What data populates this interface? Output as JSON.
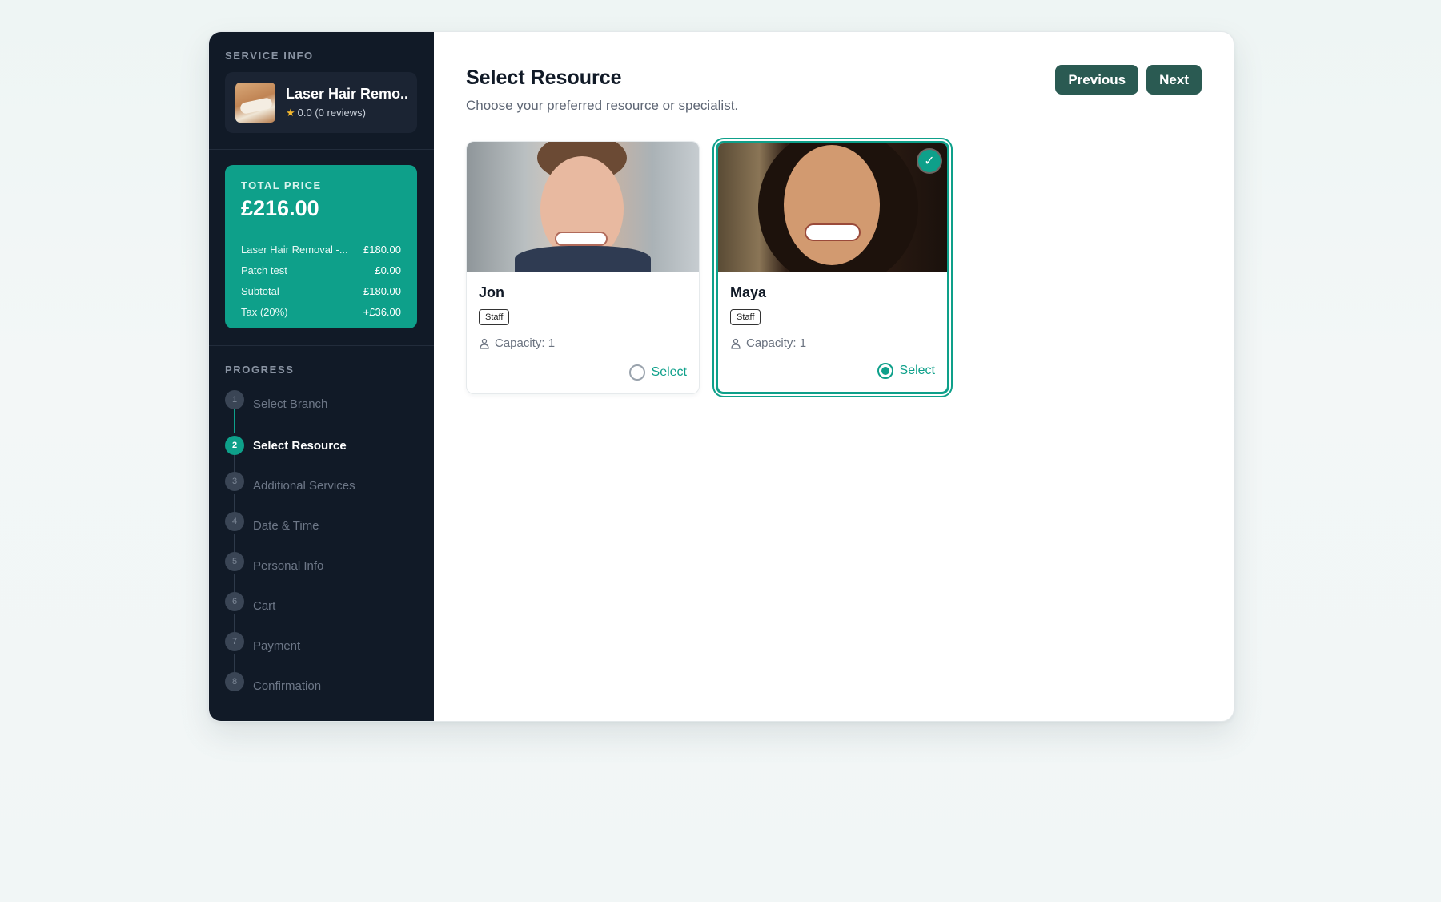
{
  "sidebar": {
    "service_info_label": "SERVICE INFO",
    "service": {
      "title": "Laser Hair Remo...",
      "rating": "0.0 (0 reviews)",
      "thumbnail_icon": "service-thumbnail"
    },
    "price": {
      "label": "TOTAL PRICE",
      "total": "£216.00",
      "rows": [
        {
          "name": "Laser Hair Removal -...",
          "value": "£180.00"
        },
        {
          "name": "Patch test",
          "value": "£0.00"
        },
        {
          "name": "Subtotal",
          "value": "£180.00"
        },
        {
          "name": "Tax (20%)",
          "value": "+£36.00"
        }
      ]
    },
    "progress_label": "PROGRESS",
    "steps": [
      {
        "num": "1",
        "label": "Select Branch",
        "state": "done"
      },
      {
        "num": "2",
        "label": "Select Resource",
        "state": "active"
      },
      {
        "num": "3",
        "label": "Additional Services",
        "state": "todo"
      },
      {
        "num": "4",
        "label": "Date & Time",
        "state": "todo"
      },
      {
        "num": "5",
        "label": "Personal Info",
        "state": "todo"
      },
      {
        "num": "6",
        "label": "Cart",
        "state": "todo"
      },
      {
        "num": "7",
        "label": "Payment",
        "state": "todo"
      },
      {
        "num": "8",
        "label": "Confirmation",
        "state": "todo"
      }
    ]
  },
  "main": {
    "title": "Select Resource",
    "subtitle": "Choose your preferred resource or specialist.",
    "buttons": {
      "previous": "Previous",
      "next": "Next"
    },
    "resources": [
      {
        "name": "Jon",
        "badge": "Staff",
        "capacity": "Capacity: 1",
        "select_label": "Select",
        "selected": false
      },
      {
        "name": "Maya",
        "badge": "Staff",
        "capacity": "Capacity: 1",
        "select_label": "Select",
        "selected": true
      }
    ]
  },
  "colors": {
    "accent": "#0ea08a",
    "sidebar": "#111a27",
    "button": "#2a5a52"
  }
}
